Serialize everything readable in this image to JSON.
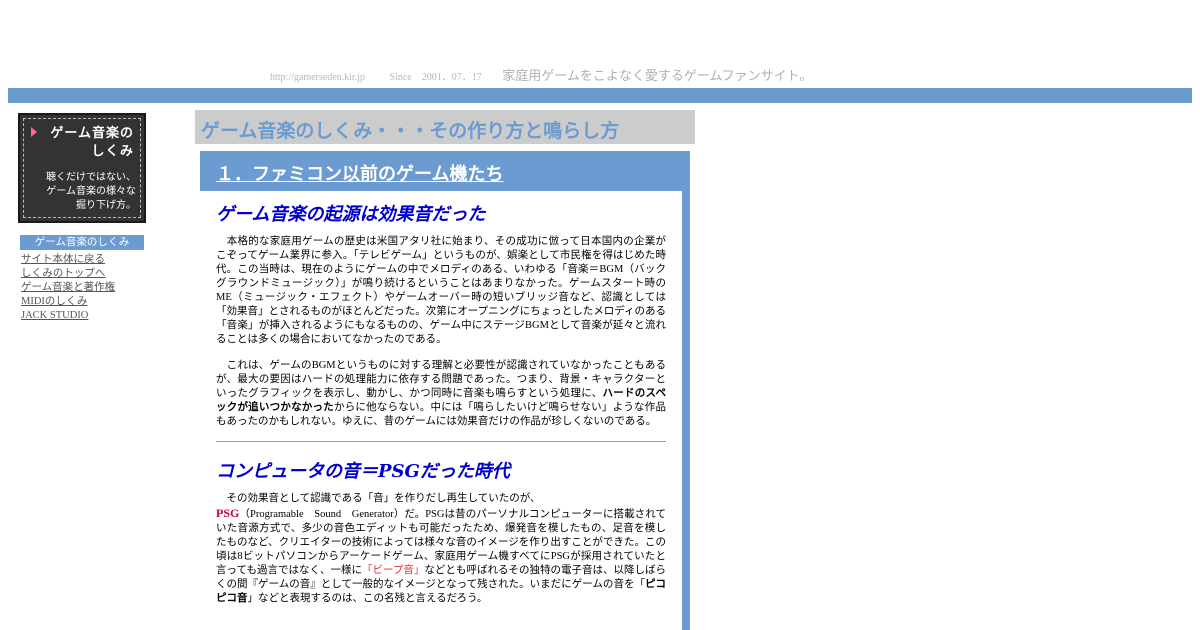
{
  "header": {
    "url": "http://gamerseden.kir.jp",
    "since": "Since　2001．07．17",
    "tagline": "家庭用ゲームをこよなく愛するゲームファンサイト。"
  },
  "sidebar": {
    "title_line1": "ゲーム音楽の",
    "title_line2": "しくみ",
    "desc_line1": "聴くだけではない、",
    "desc_line2": "ゲーム音楽の様々な",
    "desc_line3": "掘り下げ方。",
    "nav_header": "ゲーム音楽のしくみ",
    "links": [
      {
        "label": "サイト本体に戻る"
      },
      {
        "label": "しくみのトップへ"
      },
      {
        "label": "ゲーム音楽と著作権"
      },
      {
        "label": "MIDIのしくみ"
      },
      {
        "label": "JACK STUDIO"
      }
    ]
  },
  "main": {
    "page_title": "ゲーム音楽のしくみ・・・その作り方と鳴らし方",
    "section_title": "１．ファミコン以前のゲーム機たち",
    "heading1": "ゲーム音楽の起源は効果音だった",
    "para1": "　本格的な家庭用ゲームの歴史は米国アタリ社に始まり、その成功に倣って日本国内の企業がこぞってゲーム業界に参入。「テレビゲーム」というものが、娯楽として市民権を得はじめた時代。この当時は、現在のようにゲームの中でメロディのある、いわゆる「音楽＝BGM（バックグラウンドミュージック）」が鳴り続けるということはあまりなかった。ゲームスタート時のME（ミュージック・エフェクト）やゲームオーバー時の短いブリッジ音など、認識としては「効果音」とされるものがほとんどだった。次第にオープニングにちょっとしたメロディのある「音楽」が挿入されるようにもなるものの、ゲーム中にステージBGMとして音楽が延々と流れることは多くの場合においてなかったのである。",
    "para2_a": "　これは、ゲームのBGMというものに対する理解と必要性が認識されていなかったこともあるが、最大の要因はハードの処理能力に依存する問題であった。つまり、背景・キャラクターといったグラフィックを表示し、動かし、かつ同時に音楽も鳴らすという処理に、",
    "para2_bold": "ハードのスペックが追いつかなかった",
    "para2_b": "からに他ならない。中には「鳴らしたいけど鳴らせない」ような作品もあったのかもしれない。ゆえに、昔のゲームには効果音だけの作品が珍しくないのである。",
    "heading2": "コンピュータの音＝PSGだった時代",
    "para3_a": "　その効果音として認識である「音」を作りだし再生していたのが、",
    "psg": "PSG",
    "para3_b": "（Programable　Sound　Generator）だ。PSGは昔のパーソナルコンピューターに搭載されていた音源方式で、多少の音色エディットも可能だったため、爆発音を模したもの、足音を模したものなど、クリエイターの技術によっては様々な音のイメージを作り出すことができた。この頃は8ビットパソコンからアーケードゲーム、家庭用ゲーム機すべてにPSGが採用されていたと言っても過言ではなく、一様に",
    "beep": "「ビープ音」",
    "para3_c": "などとも呼ばれるその独特の電子音は、以降しばらくの間『ゲームの音』として一般的なイメージとなって残された。いまだにゲームの音を「",
    "pikopiko": "ピコピコ音",
    "para3_d": "」などと表現するのは、この名残と言えるだろう。"
  }
}
